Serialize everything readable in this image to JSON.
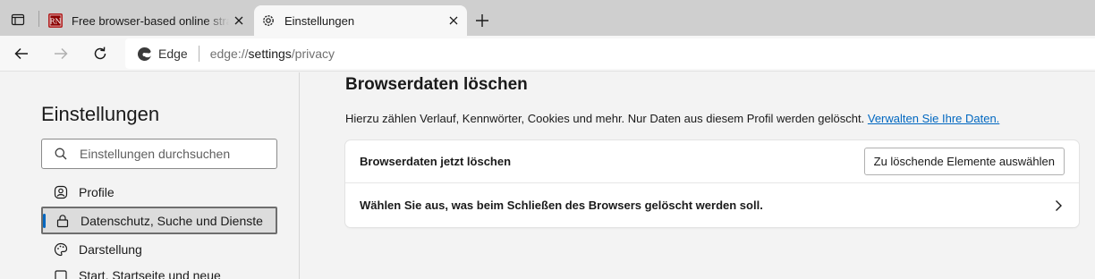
{
  "browser": {
    "tabs": [
      {
        "title": "Free browser-based online strategy",
        "favicon": "game-favicon",
        "close_icon": "close-icon"
      },
      {
        "title": "Einstellungen",
        "favicon": "gear-icon",
        "close_icon": "close-icon",
        "active": true
      }
    ],
    "address_bar": {
      "site_label": "Edge",
      "url_prefix": "edge://",
      "url_host": "settings",
      "url_path": "/privacy"
    }
  },
  "sidebar": {
    "title": "Einstellungen",
    "search_placeholder": "Einstellungen durchsuchen",
    "items": [
      {
        "label": "Profile",
        "icon": "profile-icon"
      },
      {
        "label": "Datenschutz, Suche und Dienste",
        "icon": "lock-icon",
        "active": true
      },
      {
        "label": "Darstellung",
        "icon": "palette-icon"
      },
      {
        "label": "Start, Startseite und neue",
        "icon": "home-icon"
      }
    ]
  },
  "main": {
    "section_title": "Browserdaten löschen",
    "description": "Hierzu zählen Verlauf, Kennwörter, Cookies und mehr. Nur Daten aus diesem Profil werden gelöscht.",
    "manage_link": "Verwalten Sie Ihre Daten.",
    "rows": [
      {
        "label": "Browserdaten jetzt löschen",
        "button": "Zu löschende Elemente auswählen"
      },
      {
        "label": "Wählen Sie aus, was beim Schließen des Browsers gelöscht werden soll.",
        "icon": "chevron-right-icon"
      }
    ]
  },
  "colors": {
    "accent": "#0067c0",
    "tabstrip": "#cfcfcf",
    "page_background": "#f3f3f3"
  }
}
